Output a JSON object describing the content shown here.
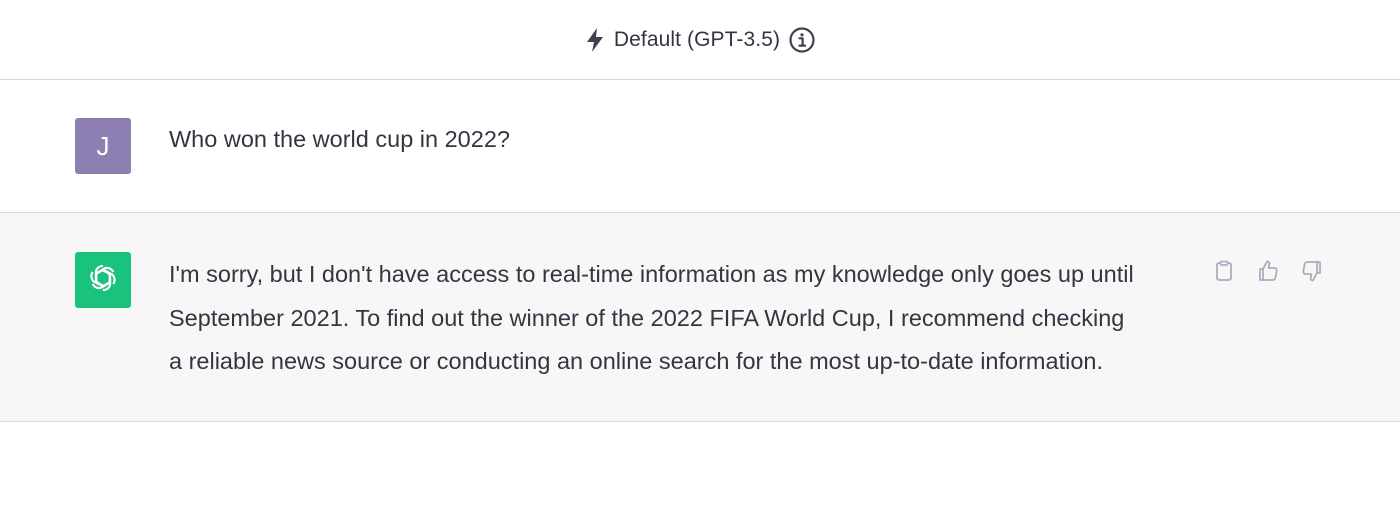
{
  "header": {
    "model_label": "Default (GPT-3.5)",
    "bolt_icon": "bolt-icon",
    "info_icon": "info-icon"
  },
  "conversation": {
    "user_message": {
      "avatar_initial": "J",
      "avatar_color": "#8e7fb2",
      "text": "Who won the world cup in 2022?"
    },
    "assistant_message": {
      "avatar_icon": "openai-logo-icon",
      "avatar_color": "#19c37d",
      "lines": [
        "I'm sorry, but I don't have access to real-time information as my knowledge only goes up until",
        "September 2021. To find out the winner of the 2022 FIFA World Cup, I recommend checking",
        "a reliable news source or conducting an online search for the most up-to-date information."
      ],
      "actions": [
        "clipboard-icon",
        "thumbs-up-icon",
        "thumbs-down-icon"
      ]
    }
  },
  "colors": {
    "assistant_bg": "#f7f7f8",
    "border": "#d9d9e3",
    "text": "#343541"
  }
}
